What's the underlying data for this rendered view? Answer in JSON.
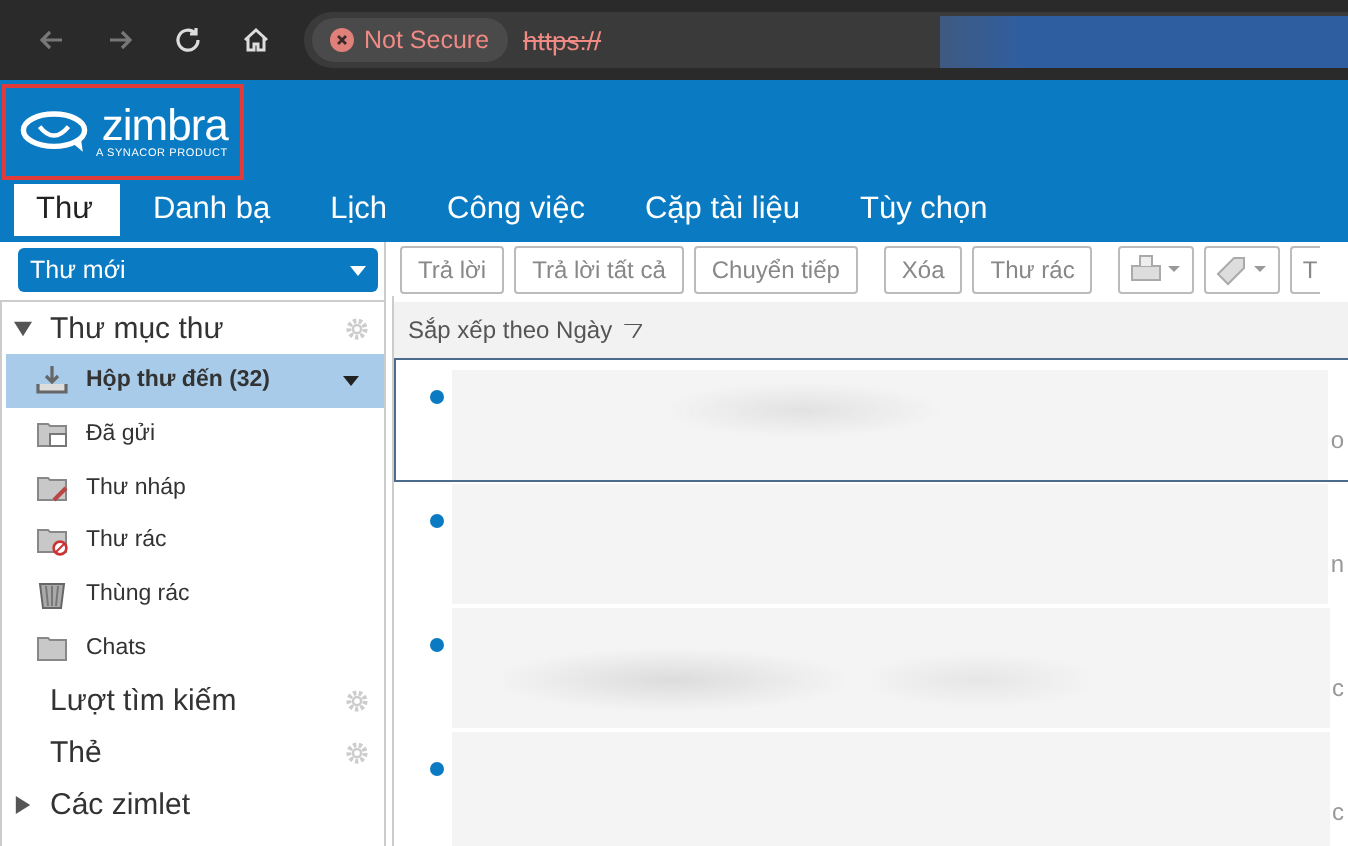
{
  "browser": {
    "security": "Not Secure",
    "url": "https://"
  },
  "logo": {
    "name": "zimbra",
    "tagline": "A SYNACOR PRODUCT",
    "highlighted": true
  },
  "tabs": [
    {
      "label": "Thư",
      "selected": true
    },
    {
      "label": "Danh bạ",
      "selected": false
    },
    {
      "label": "Lịch",
      "selected": false
    },
    {
      "label": "Công việc",
      "selected": false
    },
    {
      "label": "Cặp tài liệu",
      "selected": false
    },
    {
      "label": "Tùy chọn",
      "selected": false
    }
  ],
  "new_button": "Thư mới",
  "sidebar": [
    {
      "label": "Thư mục thư",
      "expanded": true,
      "gear": true,
      "items": [
        {
          "label": "Hộp thư đến (32)",
          "kind": "inbox",
          "selected": true
        },
        {
          "label": "Đã gửi",
          "kind": "sent",
          "selected": false
        },
        {
          "label": "Thư nháp",
          "kind": "drafts",
          "selected": false
        },
        {
          "label": "Thư rác",
          "kind": "junk",
          "selected": false
        },
        {
          "label": "Thùng rác",
          "kind": "trash",
          "selected": false
        },
        {
          "label": "Chats",
          "kind": "folder",
          "selected": false
        }
      ]
    },
    {
      "label": "Lượt tìm kiếm",
      "gear": true
    },
    {
      "label": "Thẻ",
      "gear": true
    },
    {
      "label": "Các zimlet",
      "expanded": false,
      "gear": false
    }
  ],
  "toolbar": [
    {
      "kind": "text",
      "label": "Trả lời"
    },
    {
      "kind": "text",
      "label": "Trả lời tất cả"
    },
    {
      "kind": "text",
      "label": "Chuyển tiếp"
    },
    {
      "kind": "gap"
    },
    {
      "kind": "text",
      "label": "Xóa"
    },
    {
      "kind": "text",
      "label": "Thư rác"
    },
    {
      "kind": "gap"
    },
    {
      "kind": "print"
    },
    {
      "kind": "tag"
    },
    {
      "kind": "cut",
      "label": "T"
    }
  ],
  "message_list": {
    "sort_label": "Sắp xếp theo Ngày",
    "messages": [
      {
        "unread": true,
        "selected": true,
        "snippet": "o"
      },
      {
        "unread": true,
        "selected": false,
        "snippet": "n"
      },
      {
        "unread": true,
        "selected": false,
        "snippet": "c"
      },
      {
        "unread": true,
        "selected": false,
        "snippet": "c"
      }
    ]
  }
}
